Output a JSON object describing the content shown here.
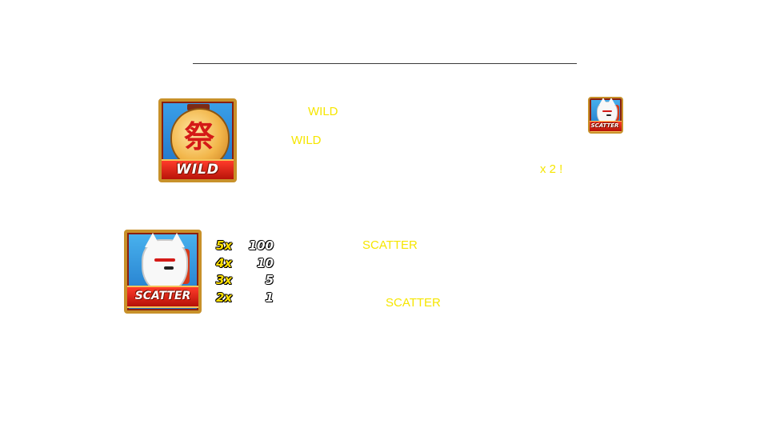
{
  "wild_section": {
    "symbol_label": "WILD",
    "symbol_glyph": "祭",
    "text_lines": [
      {
        "text": "WILD"
      },
      {
        "text": "WILD"
      },
      {
        "text": "x 2 !"
      }
    ],
    "inline_icon_label": "SCATTER"
  },
  "scatter_section": {
    "symbol_label": "SCATTER",
    "paytable": [
      {
        "count": "5x",
        "value": "100"
      },
      {
        "count": "4x",
        "value": "10"
      },
      {
        "count": "3x",
        "value": "5"
      },
      {
        "count": "2x",
        "value": "1"
      }
    ],
    "text_lines": [
      {
        "text": "SCATTER"
      },
      {
        "text": "SCATTER"
      }
    ]
  },
  "colors": {
    "highlight_text": "#f6e600",
    "tile_blue": "#1e6fc4",
    "tile_gold": "#c8912a",
    "banner_red": "#d41a17"
  }
}
